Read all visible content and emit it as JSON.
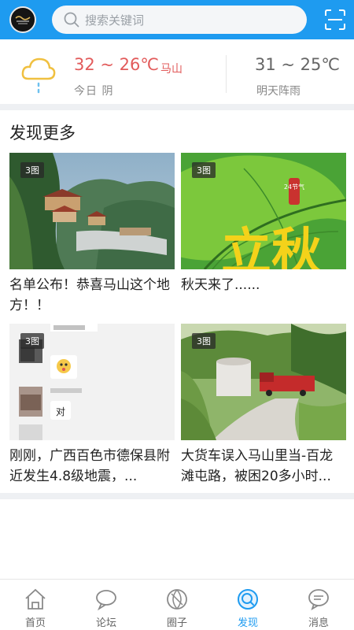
{
  "header": {
    "search_placeholder": "搜索关键词",
    "accent_color": "#1e9bf0"
  },
  "weather": {
    "today_temp": "32 ~ 26℃",
    "city": "马山",
    "today_desc": "今日 阴",
    "tomorrow_temp": "31 ~ 25℃",
    "tomorrow_desc": "明天阵雨",
    "icon": "cloud-rain-icon"
  },
  "section": {
    "title": "发现更多"
  },
  "cards": [
    {
      "badge": "3图",
      "title": "名单公布！恭喜马山这个地方！！"
    },
    {
      "badge": "3图",
      "title": "秋天来了......",
      "image_text": "立秋",
      "image_subtext": "24节气"
    },
    {
      "badge": "3图",
      "title": "刚刚，广西百色市德保县附近发生4.8级地震，...",
      "chat_reply": "对"
    },
    {
      "badge": "3图",
      "title": "大货车误入马山里当-百龙滩屯路，被困20多小时..."
    }
  ],
  "nav": [
    {
      "label": "首页",
      "icon": "home-icon"
    },
    {
      "label": "论坛",
      "icon": "chat-bubble-icon"
    },
    {
      "label": "圈子",
      "icon": "circle-icon"
    },
    {
      "label": "发现",
      "icon": "discover-icon",
      "active": true
    },
    {
      "label": "消息",
      "icon": "message-icon"
    }
  ]
}
